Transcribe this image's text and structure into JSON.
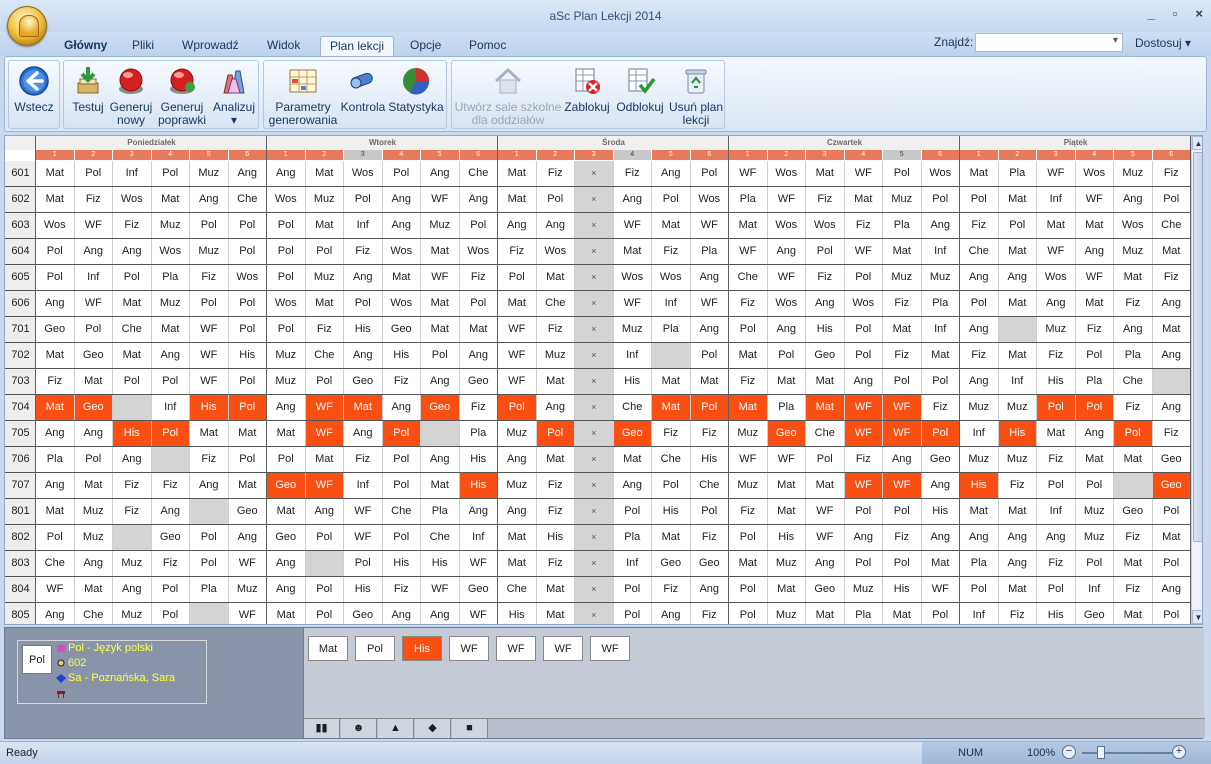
{
  "window": {
    "title": "aSc Plan Lekcji 2014",
    "controls": [
      "_",
      "▫",
      "×"
    ]
  },
  "tabs": [
    "Główny",
    "Pliki",
    "Wprowadź",
    "Widok",
    "Plan lekcji",
    "Opcje",
    "Pomoc"
  ],
  "active_tab": "Plan lekcji",
  "search": {
    "label": "Znajdź:",
    "value": ""
  },
  "customize_label": "Dostosuj",
  "ribbon": {
    "back": "Wstecz",
    "test": "Testuj",
    "generate_new": [
      "Generuj",
      "nowy"
    ],
    "generate_fix": [
      "Generuj",
      "poprawki"
    ],
    "analyze": "Analizuj",
    "params": [
      "Parametry",
      "generowania"
    ],
    "control": "Kontrola",
    "stats": "Statystyka",
    "create_rooms": [
      "Utwórz sale szkolne",
      "dla oddziałów"
    ],
    "block": "Zablokuj",
    "unblock": "Odblokuj",
    "delete_plan": [
      "Usuń plan",
      "lekcji"
    ]
  },
  "days": [
    "Poniedziałek",
    "Wtorek",
    "Środa",
    "Czwartek",
    "Piątek"
  ],
  "periods": [
    "1",
    "2",
    "3",
    "4",
    "5",
    "6"
  ],
  "grid": [
    {
      "cls": "601",
      "cells": [
        "Mat",
        "Pol",
        "Inf",
        "Pol",
        "Muz",
        "Ang",
        "Ang",
        "Mat",
        "Wos",
        "Pol",
        "Ang",
        "Che",
        "Mat",
        "Fiz",
        "×",
        "Fiz",
        "Ang",
        "Pol",
        "WF",
        "Wos",
        "Mat",
        "WF",
        "Pol",
        "Wos",
        "Mat",
        "Pla",
        "WF",
        "Wos",
        "Muz",
        "Fiz"
      ],
      "hl": []
    },
    {
      "cls": "602",
      "cells": [
        "Mat",
        "Fiz",
        "Wos",
        "Mat",
        "Ang",
        "Che",
        "Wos",
        "Muz",
        "Pol",
        "Ang",
        "WF",
        "Ang",
        "Mat",
        "Pol",
        "×",
        "Ang",
        "Pol",
        "Wos",
        "Pla",
        "WF",
        "Fiz",
        "Mat",
        "Muz",
        "Pol",
        "Pol",
        "Mat",
        "Inf",
        "WF",
        "Ang",
        "Pol"
      ],
      "hl": []
    },
    {
      "cls": "603",
      "cells": [
        "Wos",
        "WF",
        "Fiz",
        "Muz",
        "Pol",
        "Pol",
        "Pol",
        "Mat",
        "Inf",
        "Ang",
        "Muz",
        "Pol",
        "Ang",
        "Ang",
        "×",
        "WF",
        "Mat",
        "WF",
        "Mat",
        "Wos",
        "Wos",
        "Fiz",
        "Pla",
        "Ang",
        "Fiz",
        "Pol",
        "Mat",
        "Mat",
        "Wos",
        "Che"
      ],
      "hl": []
    },
    {
      "cls": "604",
      "cells": [
        "Pol",
        "Ang",
        "Ang",
        "Wos",
        "Muz",
        "Pol",
        "Pol",
        "Pol",
        "Fiz",
        "Wos",
        "Mat",
        "Wos",
        "Fiz",
        "Wos",
        "×",
        "Mat",
        "Fiz",
        "Pla",
        "WF",
        "Ang",
        "Pol",
        "WF",
        "Mat",
        "Inf",
        "Che",
        "Mat",
        "WF",
        "Ang",
        "Muz",
        "Mat"
      ],
      "hl": []
    },
    {
      "cls": "605",
      "cells": [
        "Pol",
        "Inf",
        "Pol",
        "Pla",
        "Fiz",
        "Wos",
        "Pol",
        "Muz",
        "Ang",
        "Mat",
        "WF",
        "Fiz",
        "Pol",
        "Mat",
        "×",
        "Wos",
        "Wos",
        "Ang",
        "Che",
        "WF",
        "Fiz",
        "Pol",
        "Muz",
        "Muz",
        "Ang",
        "Ang",
        "Wos",
        "WF",
        "Mat",
        "Fiz"
      ],
      "hl": []
    },
    {
      "cls": "606",
      "cells": [
        "Ang",
        "WF",
        "Mat",
        "Muz",
        "Pol",
        "Pol",
        "Wos",
        "Mat",
        "Pol",
        "Wos",
        "Mat",
        "Pol",
        "Mat",
        "Che",
        "×",
        "WF",
        "Inf",
        "WF",
        "Fiz",
        "Wos",
        "Ang",
        "Wos",
        "Fiz",
        "Pla",
        "Pol",
        "Mat",
        "Ang",
        "Mat",
        "Fiz",
        "Ang"
      ],
      "hl": []
    },
    {
      "cls": "701",
      "cells": [
        "Geo",
        "Pol",
        "Che",
        "Mat",
        "WF",
        "Pol",
        "Pol",
        "Fiz",
        "His",
        "Geo",
        "Mat",
        "Mat",
        "WF",
        "Fiz",
        "×",
        "Muz",
        "Pla",
        "Ang",
        "Pol",
        "Ang",
        "His",
        "Pol",
        "Mat",
        "Inf",
        "Ang",
        "",
        "Muz",
        "Fiz",
        "Ang",
        "Mat"
      ],
      "hl": []
    },
    {
      "cls": "702",
      "cells": [
        "Mat",
        "Geo",
        "Mat",
        "Ang",
        "WF",
        "His",
        "Muz",
        "Che",
        "Ang",
        "His",
        "Pol",
        "Ang",
        "WF",
        "Muz",
        "×",
        "Inf",
        "",
        "Pol",
        "Mat",
        "Pol",
        "Geo",
        "Pol",
        "Fiz",
        "Mat",
        "Fiz",
        "Mat",
        "Fiz",
        "Pol",
        "Pla",
        "Ang"
      ],
      "hl": []
    },
    {
      "cls": "703",
      "cells": [
        "Fiz",
        "Mat",
        "Pol",
        "Pol",
        "WF",
        "Pol",
        "Muz",
        "Pol",
        "Geo",
        "Fiz",
        "Ang",
        "Geo",
        "WF",
        "Mat",
        "×",
        "His",
        "Mat",
        "Mat",
        "Fiz",
        "Mat",
        "Mat",
        "Ang",
        "Pol",
        "Pol",
        "Ang",
        "Inf",
        "His",
        "Pla",
        "Che",
        ""
      ],
      "hl": []
    },
    {
      "cls": "704",
      "cells": [
        "Mat",
        "Geo",
        "",
        "Inf",
        "His",
        "Pol",
        "Ang",
        "WF",
        "Mat",
        "Ang",
        "Geo",
        "Fiz",
        "Pol",
        "Ang",
        "×",
        "Che",
        "Mat",
        "Pol",
        "Mat",
        "Pla",
        "Mat",
        "WF",
        "WF",
        "Fiz",
        "Muz",
        "Muz",
        "Pol",
        "Pol",
        "Fiz",
        "Ang"
      ],
      "hl": [
        0,
        1,
        2,
        4,
        5,
        7,
        8,
        10,
        12,
        16,
        17,
        18,
        20,
        21,
        22,
        26,
        27
      ]
    },
    {
      "cls": "705",
      "cells": [
        "Ang",
        "Ang",
        "His",
        "Pol",
        "Mat",
        "Mat",
        "Mat",
        "WF",
        "Ang",
        "Pol",
        "",
        "Pla",
        "Muz",
        "Pol",
        "×",
        "Geo",
        "Fiz",
        "Fiz",
        "Muz",
        "Geo",
        "Che",
        "WF",
        "WF",
        "Pol",
        "Inf",
        "His",
        "Mat",
        "Ang",
        "Pol",
        "Fiz"
      ],
      "hl": [
        2,
        3,
        7,
        9,
        13,
        15,
        19,
        21,
        22,
        23,
        25,
        28
      ]
    },
    {
      "cls": "706",
      "cells": [
        "Pla",
        "Pol",
        "Ang",
        "",
        "Fiz",
        "Pol",
        "Pol",
        "Mat",
        "Fiz",
        "Pol",
        "Ang",
        "His",
        "Ang",
        "Mat",
        "×",
        "Mat",
        "Che",
        "His",
        "WF",
        "WF",
        "Pol",
        "Fiz",
        "Ang",
        "Geo",
        "Muz",
        "Muz",
        "Fiz",
        "Mat",
        "Mat",
        "Geo"
      ],
      "hl": []
    },
    {
      "cls": "707",
      "cells": [
        "Ang",
        "Mat",
        "Fiz",
        "Fiz",
        "Ang",
        "Mat",
        "Geo",
        "WF",
        "Inf",
        "Pol",
        "Mat",
        "His",
        "Muz",
        "Fiz",
        "×",
        "Ang",
        "Pol",
        "Che",
        "Muz",
        "Mat",
        "Mat",
        "WF",
        "WF",
        "Ang",
        "His",
        "Fiz",
        "Pol",
        "Pol",
        "",
        "Geo"
      ],
      "hl": [
        6,
        7,
        11,
        21,
        22,
        24,
        29
      ]
    },
    {
      "cls": "801",
      "cells": [
        "Mat",
        "Muz",
        "Fiz",
        "Ang",
        "",
        "Geo",
        "Mat",
        "Ang",
        "WF",
        "Che",
        "Pla",
        "Ang",
        "Ang",
        "Fiz",
        "×",
        "Pol",
        "His",
        "Pol",
        "Fiz",
        "Mat",
        "WF",
        "Pol",
        "Pol",
        "His",
        "Mat",
        "Mat",
        "Inf",
        "Muz",
        "Geo",
        "Pol"
      ],
      "hl": []
    },
    {
      "cls": "802",
      "cells": [
        "Pol",
        "Muz",
        "",
        "Geo",
        "Pol",
        "Ang",
        "Geo",
        "Pol",
        "WF",
        "Pol",
        "Che",
        "Inf",
        "Mat",
        "His",
        "×",
        "Pla",
        "Mat",
        "Fiz",
        "Pol",
        "His",
        "WF",
        "Ang",
        "Fiz",
        "Ang",
        "Ang",
        "Ang",
        "Ang",
        "Muz",
        "Fiz",
        "Mat"
      ],
      "hl": []
    },
    {
      "cls": "803",
      "cells": [
        "Che",
        "Ang",
        "Muz",
        "Fiz",
        "Pol",
        "WF",
        "Ang",
        "",
        "Pol",
        "His",
        "His",
        "WF",
        "Mat",
        "Fiz",
        "×",
        "Inf",
        "Geo",
        "Geo",
        "Mat",
        "Muz",
        "Ang",
        "Pol",
        "Pol",
        "Mat",
        "Pla",
        "Ang",
        "Fiz",
        "Pol",
        "Mat",
        "Pol"
      ],
      "hl": []
    },
    {
      "cls": "804",
      "cells": [
        "WF",
        "Mat",
        "Ang",
        "Pol",
        "Pla",
        "Muz",
        "Ang",
        "Pol",
        "His",
        "Fiz",
        "WF",
        "Geo",
        "Che",
        "Mat",
        "×",
        "Pol",
        "Fiz",
        "Ang",
        "Pol",
        "Mat",
        "Geo",
        "Muz",
        "His",
        "WF",
        "Pol",
        "Mat",
        "Pol",
        "Inf",
        "Fiz",
        "Ang"
      ],
      "hl": []
    },
    {
      "cls": "805",
      "cells": [
        "Ang",
        "Che",
        "Muz",
        "Pol",
        "",
        "WF",
        "Mat",
        "Pol",
        "Geo",
        "Ang",
        "Ang",
        "WF",
        "His",
        "Mat",
        "×",
        "Pol",
        "Ang",
        "Fiz",
        "Pol",
        "Muz",
        "Mat",
        "Pla",
        "Mat",
        "Pol",
        "Inf",
        "Fiz",
        "His",
        "Geo",
        "Mat",
        "Pol"
      ],
      "hl": []
    }
  ],
  "gray_periods": [
    8,
    15,
    22
  ],
  "gray_cells": [
    [
      6,
      25
    ],
    [
      7,
      16
    ],
    [
      8,
      29
    ],
    [
      9,
      2
    ],
    [
      10,
      10
    ],
    [
      11,
      3
    ],
    [
      12,
      28
    ],
    [
      13,
      4
    ],
    [
      14,
      2
    ],
    [
      15,
      7
    ],
    [
      17,
      4
    ]
  ],
  "info_panel": {
    "card": "Pol",
    "subject": "Pol - Język polski",
    "class": "602",
    "teacher": "Sa - Poznańska, Sara",
    "room": ""
  },
  "tray_cards": [
    {
      "label": "Mat",
      "hl": false
    },
    {
      "label": "Pol",
      "hl": false
    },
    {
      "label": "His",
      "hl": true
    },
    {
      "label": "WF",
      "hl": false
    },
    {
      "label": "WF",
      "hl": false
    },
    {
      "label": "WF",
      "hl": false
    },
    {
      "label": "WF",
      "hl": false
    }
  ],
  "status": {
    "left": "Ready",
    "num": "NUM",
    "zoom": "100%"
  },
  "colors": {
    "highlight": "#fa4f12",
    "period_header": "#e8795a",
    "ribbon_bg": "#dae6f4"
  }
}
